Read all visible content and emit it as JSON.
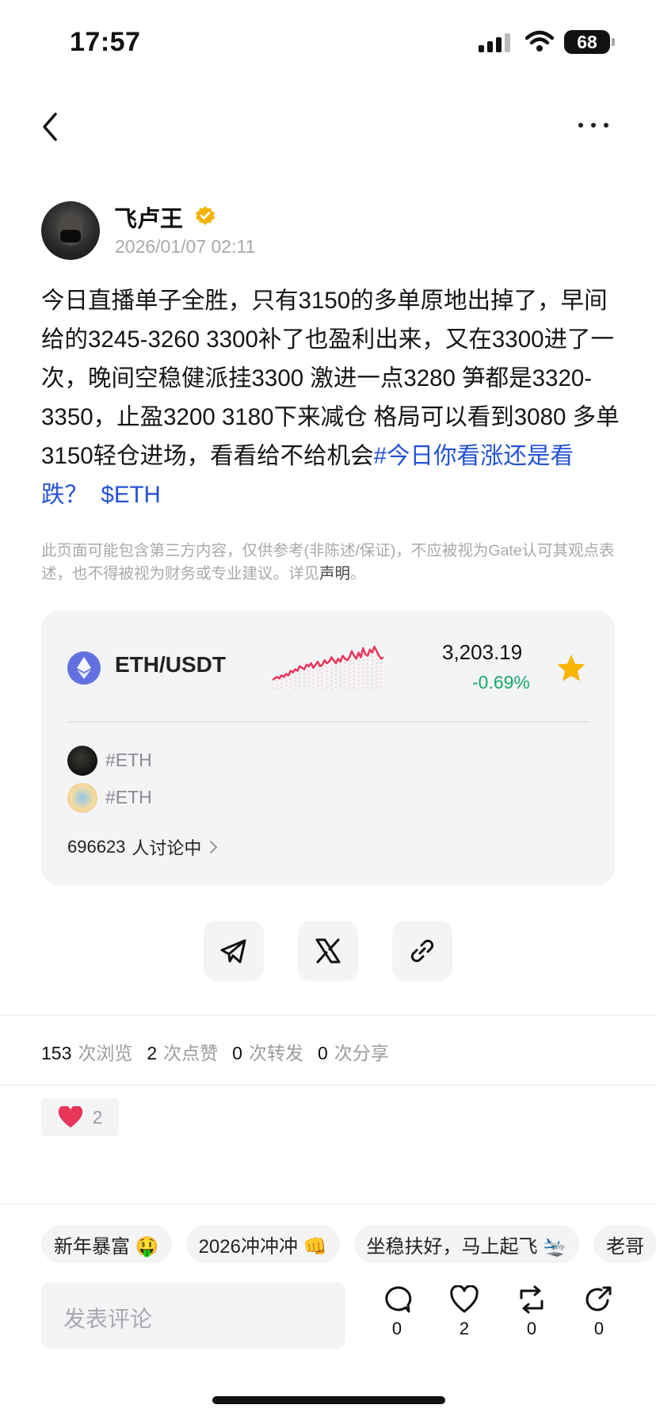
{
  "status_bar": {
    "time": "17:57",
    "battery": "68"
  },
  "author": {
    "name": "飞卢王",
    "date": "2026/01/07 02:11"
  },
  "post": {
    "body": "今日直播单子全胜，只有3150的多单原地出掉了，早间给的3245-3260 3300补了也盈利出来，又在3300进了一次，晚间空稳健派挂3300 激进一点3280 笋都是3320-3350，止盈3200 3180下来减仓 格局可以看到3080 多单3150轻仓进场，看看给不给机会",
    "hashtag": "#今日你看涨还是看跌？",
    "cashtag": "$ETH"
  },
  "disclaimer": {
    "text": "此页面可能包含第三方内容，仅供参考(非陈述/保证)，不应被视为Gate认可其观点表述，也不得被视为财务或专业建议。详见",
    "link": "声明",
    "end": "。"
  },
  "market": {
    "pair": "ETH/USDT",
    "price": "3,203.19",
    "change": "-0.69%",
    "accent_up": "#1aa86b",
    "spark_color": "#e8355a",
    "spark_values": [
      3,
      4,
      5,
      4,
      6,
      5,
      7,
      6,
      9,
      8,
      10,
      9,
      12,
      11,
      10,
      13,
      12,
      14,
      11,
      13,
      15,
      12,
      13,
      16,
      14,
      15,
      18,
      16,
      14,
      17,
      15,
      19,
      17,
      16,
      18,
      22,
      19,
      17,
      21,
      18,
      24,
      20,
      19,
      23,
      21,
      25,
      22,
      19,
      17,
      18
    ],
    "topics": [
      "#ETH",
      "#ETH"
    ],
    "discuss_count": "696623",
    "discuss_label": "人讨论中"
  },
  "stats": [
    {
      "num": "153",
      "label": "次浏览"
    },
    {
      "num": "2",
      "label": "次点赞"
    },
    {
      "num": "0",
      "label": "次转发"
    },
    {
      "num": "0",
      "label": "次分享"
    }
  ],
  "reaction": {
    "count": "2"
  },
  "quick_replies": [
    "新年暴富 🤑",
    "2026冲冲冲 👊",
    "坐稳扶好，马上起飞 🛬",
    "老哥"
  ],
  "comment": {
    "placeholder": "发表评论"
  },
  "actions": {
    "comments": "0",
    "likes": "2",
    "reposts": "0",
    "shares": "0"
  },
  "icons": [
    "back-icon",
    "more-icon",
    "verified-icon",
    "eth-icon",
    "star-icon",
    "telegram-icon",
    "x-icon",
    "link-icon",
    "heart-icon",
    "comment-icon",
    "like-icon",
    "repost-icon",
    "share-icon"
  ]
}
